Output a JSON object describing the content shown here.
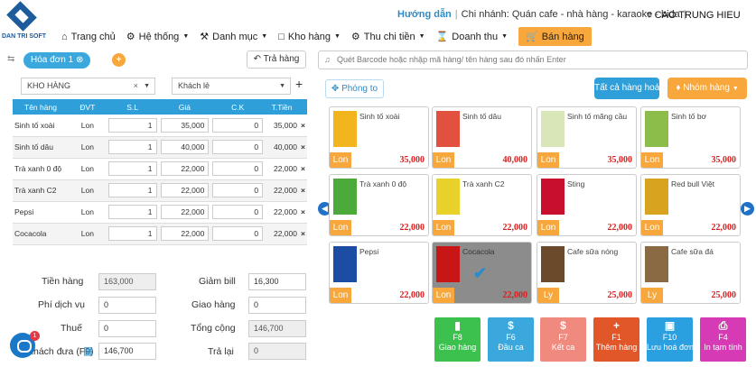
{
  "brand": {
    "logo_text": "DAN TRI SOFT"
  },
  "topbar": {
    "guide": "Hướng dẫn",
    "branch": "Chi nhánh: Quán cafe - nhà hàng - karaoke - bida",
    "user": "CAO TRUNG HIEU"
  },
  "nav": {
    "home": "Trang chủ",
    "system": "Hệ thống",
    "catalog": "Danh mục",
    "warehouse": "Kho hàng",
    "cashflow": "Thu chi tiền",
    "revenue": "Doanh thu",
    "sell": "Bán hàng"
  },
  "order": {
    "tab": "Hóa đơn 1",
    "return_btn": "Trả hàng",
    "warehouse": "KHO HÀNG",
    "customer": "Khách lẻ"
  },
  "table": {
    "headers": [
      "Tên hàng",
      "ĐVT",
      "S.L",
      "Giá",
      "C.K",
      "T.Tiền"
    ],
    "rows": [
      {
        "name": "Sinh tố xoài",
        "unit": "Lon",
        "qty": "1",
        "price": "35,000",
        "disc": "0",
        "total": "35,000"
      },
      {
        "name": "Sinh tố dâu",
        "unit": "Lon",
        "qty": "1",
        "price": "40,000",
        "disc": "0",
        "total": "40,000"
      },
      {
        "name": "Trà xanh 0 độ",
        "unit": "Lon",
        "qty": "1",
        "price": "22,000",
        "disc": "0",
        "total": "22,000"
      },
      {
        "name": "Trà xanh C2",
        "unit": "Lon",
        "qty": "1",
        "price": "22,000",
        "disc": "0",
        "total": "22,000"
      },
      {
        "name": "Pepsi",
        "unit": "Lon",
        "qty": "1",
        "price": "22,000",
        "disc": "0",
        "total": "22,000"
      },
      {
        "name": "Cocacola",
        "unit": "Lon",
        "qty": "1",
        "price": "22,000",
        "disc": "0",
        "total": "22,000"
      }
    ]
  },
  "summary": {
    "goods_label": "Tiền hàng",
    "goods": "163,000",
    "service_label": "Phí dịch vụ",
    "service": "0",
    "tax_label": "Thuế",
    "tax": "0",
    "paid_label": "Khách đưa (F9)",
    "paid": "146,700",
    "discount_label": "Giảm bill",
    "discount": "16,300",
    "delivery_label": "Giao hàng",
    "delivery": "0",
    "total_label": "Tổng cộng",
    "total": "146,700",
    "change_label": "Trả lại",
    "change": "0"
  },
  "chat": {
    "badge": "1"
  },
  "catalog": {
    "search_placeholder": "Quét Barcode hoặc nhập mã hàng/ tên hàng sau đó nhấn Enter",
    "zoom": "Phóng to",
    "all": "Tất cả hàng hoá",
    "groups": "Nhóm hàng",
    "products": [
      {
        "name": "Sinh tố xoài",
        "unit": "Lon",
        "price": "35,000",
        "color": "#f2b51d"
      },
      {
        "name": "Sinh tố dâu",
        "unit": "Lon",
        "price": "40,000",
        "color": "#e2503f"
      },
      {
        "name": "Sinh tố mãng cầu",
        "unit": "Lon",
        "price": "35,000",
        "color": "#d9e7b8"
      },
      {
        "name": "Sinh tố bơ",
        "unit": "Lon",
        "price": "35,000",
        "color": "#8cbc4a"
      },
      {
        "name": "Trà xanh 0 độ",
        "unit": "Lon",
        "price": "22,000",
        "color": "#4caa3b"
      },
      {
        "name": "Trà xanh C2",
        "unit": "Lon",
        "price": "22,000",
        "color": "#e8d12a"
      },
      {
        "name": "Sting",
        "unit": "Lon",
        "price": "22,000",
        "color": "#c8102e"
      },
      {
        "name": "Red bull Việt",
        "unit": "Lon",
        "price": "22,000",
        "color": "#d8a420"
      },
      {
        "name": "Pepsi",
        "unit": "Lon",
        "price": "22,000",
        "color": "#1d4ca3"
      },
      {
        "name": "Cocacola",
        "unit": "Lon",
        "price": "22,000",
        "color": "#c81616"
      },
      {
        "name": "Cafe sữa nóng",
        "unit": "Ly",
        "price": "25,000",
        "color": "#6b4a2c"
      },
      {
        "name": "Cafe sữa đá",
        "unit": "Ly",
        "price": "25,000",
        "color": "#8a6a43"
      }
    ]
  },
  "actions": [
    {
      "key": "F8",
      "label": "Giao hàng",
      "color": "#3cc14e",
      "icon": "▮"
    },
    {
      "key": "F6",
      "label": "Đầu ca",
      "color": "#3aa8dd",
      "icon": "$"
    },
    {
      "key": "F7",
      "label": "Kết ca",
      "color": "#f08a7e",
      "icon": "$"
    },
    {
      "key": "F1",
      "label": "Thêm hàng",
      "color": "#e2572a",
      "icon": "+"
    },
    {
      "key": "F10",
      "label": "Lưu hoá đơn",
      "color": "#2aa0e0",
      "icon": "▣"
    },
    {
      "key": "F4",
      "label": "In tạm tính",
      "color": "#d63ab5",
      "icon": "⎙"
    }
  ]
}
